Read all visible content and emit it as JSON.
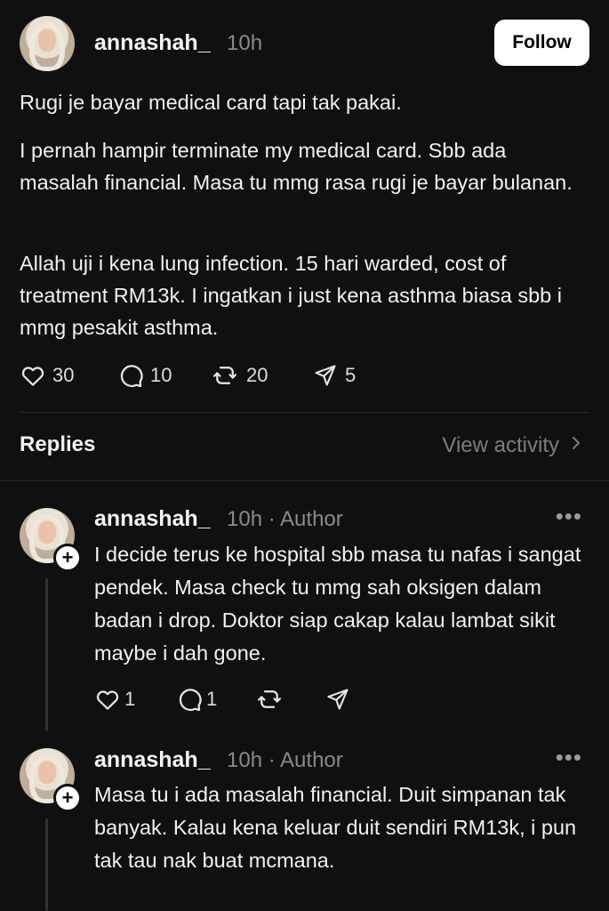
{
  "post": {
    "username": "annashah_",
    "time": "10h",
    "follow_label": "Follow",
    "paragraphs": [
      "Rugi je bayar medical card tapi tak pakai.",
      "I pernah hampir terminate my medical card. Sbb ada masalah financial. Masa tu mmg rasa rugi je bayar bulanan.",
      "Allah uji i kena lung infection. 15 hari warded, cost of treatment RM13k. I ingatkan i just kena asthma biasa sbb i mmg pesakit asthma."
    ],
    "likes": "30",
    "comments": "10",
    "reposts": "20",
    "shares": "5"
  },
  "replies_section": {
    "title": "Replies",
    "view_activity": "View activity"
  },
  "replies": [
    {
      "username": "annashah_",
      "meta": "10h · Author",
      "text": "I decide terus ke hospital sbb masa tu nafas i sangat pendek. Masa check tu mmg sah oksigen dalam badan i drop. Doktor siap cakap kalau lambat sikit maybe i dah gone.",
      "likes": "1",
      "comments": "1"
    },
    {
      "username": "annashah_",
      "meta": "10h · Author",
      "text": "Masa tu i ada masalah financial. Duit simpanan tak banyak. Kalau kena keluar duit sendiri RM13k, i pun tak tau nak buat mcmana."
    }
  ],
  "icons": {
    "more": "more-icon",
    "heart": "heart-icon",
    "comment": "comment-icon",
    "repost": "repost-icon",
    "share": "share-icon",
    "chevron": "chevron-right-icon",
    "plus": "plus-icon"
  },
  "colors": {
    "background": "#101010",
    "text": "#f3f3f3",
    "muted": "#8a8a8a",
    "follow_bg": "#ffffff"
  }
}
